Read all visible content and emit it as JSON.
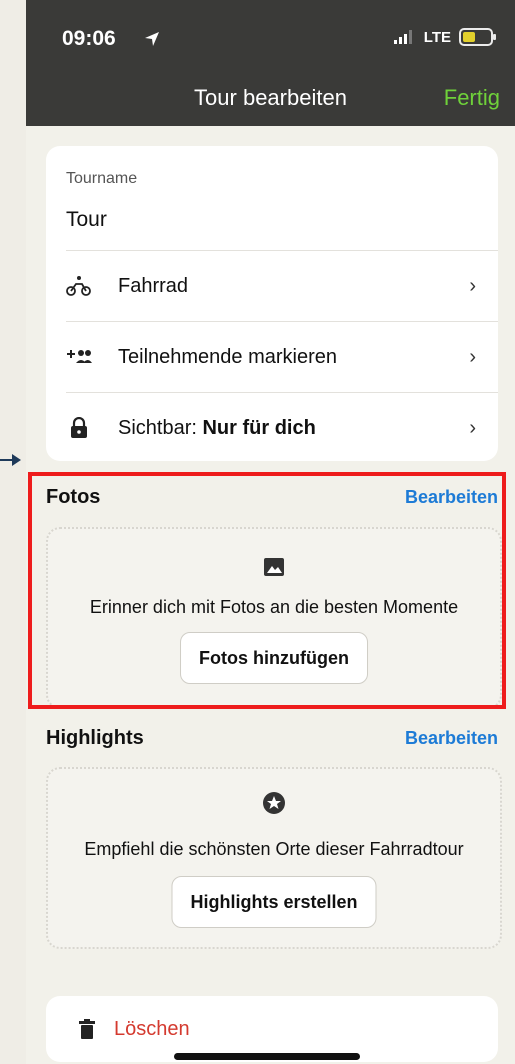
{
  "status_bar": {
    "time": "09:06",
    "network": "LTE"
  },
  "nav": {
    "title": "Tour bearbeiten",
    "done": "Fertig"
  },
  "tour": {
    "name_label": "Tourname",
    "name_value": "Tour",
    "sport": "Fahrrad",
    "participants": "Teilnehmende markieren",
    "visibility_prefix": "Sichtbar: ",
    "visibility_value": "Nur für dich"
  },
  "photos": {
    "header": "Fotos",
    "edit": "Bearbeiten",
    "text": "Erinner dich mit Fotos an die besten Momente",
    "button": "Fotos hinzufügen"
  },
  "highlights": {
    "header": "Highlights",
    "edit": "Bearbeiten",
    "text": "Empfiehl die schönsten Orte dieser Fahrradtour",
    "button": "Highlights erstellen"
  },
  "delete": {
    "label": "Löschen"
  },
  "colors": {
    "accent_green": "#6fd13a",
    "link_blue": "#1d7bd6",
    "danger_red": "#d43a2f",
    "highlight_red": "#ee1c1c",
    "topbar": "#3a3a38"
  }
}
